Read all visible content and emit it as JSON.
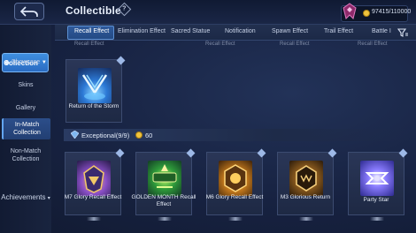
{
  "header": {
    "title": "Collectible",
    "info_glyph": "?",
    "currency_value": "97415/110000",
    "emblem_icon": "rank-emblem-icon",
    "coin_icon": "coin-icon",
    "back_icon": "back-arrow-icon"
  },
  "sidebar": {
    "collection_label": "Collection",
    "items": [
      {
        "label": "Showcase"
      },
      {
        "label": "Skins"
      },
      {
        "label": "Gallery"
      },
      {
        "label": "In-Match Collection"
      },
      {
        "label": "Non-Match Collection"
      }
    ],
    "achievements_label": "Achievements"
  },
  "tabs": [
    {
      "label": "Recall Effect",
      "active": true
    },
    {
      "label": "Elimination Effect"
    },
    {
      "label": "Sacred Statue"
    },
    {
      "label": "Notification"
    },
    {
      "label": "Spawn Effect"
    },
    {
      "label": "Trail Effect"
    },
    {
      "label": "Battle I"
    }
  ],
  "filter_icon": "filter-icon",
  "partial_rows": [
    "Recall Effect",
    "Recall Effect",
    "Recall Effect",
    "Recall Effect"
  ],
  "top_card": {
    "name": "Return of the Storm"
  },
  "section": {
    "title": "Exceptional(9/9)",
    "count": "60"
  },
  "cards": [
    {
      "name": "M7 Glory Recall Effect"
    },
    {
      "name": "GOLDEN MONTH Recall Effect"
    },
    {
      "name": "M6 Glory Recall Effect"
    },
    {
      "name": "M3 Glorious Return"
    },
    {
      "name": "Party Star"
    }
  ],
  "colors": {
    "accent": "#3f8fe0",
    "background": "#172241",
    "coin": "#f0c33d"
  }
}
